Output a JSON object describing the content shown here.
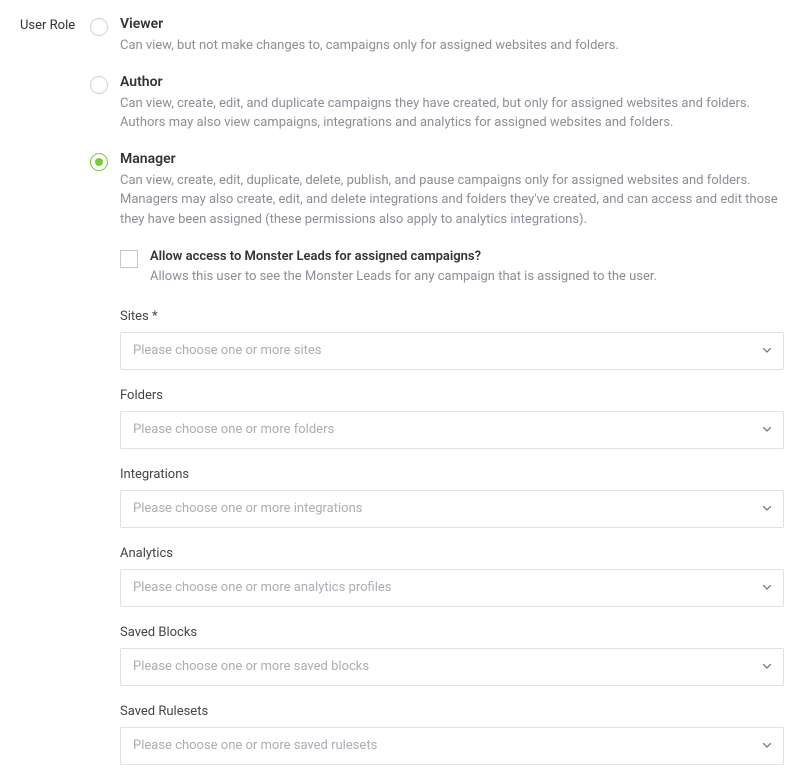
{
  "section_label": "User Role",
  "roles": {
    "viewer": {
      "title": "Viewer",
      "desc": "Can view, but not make changes to, campaigns only for assigned websites and folders."
    },
    "author": {
      "title": "Author",
      "desc": "Can view, create, edit, and duplicate campaigns they have created, but only for assigned websites and folders. Authors may also view campaigns, integrations and analytics for assigned websites and folders."
    },
    "manager": {
      "title": "Manager",
      "desc": "Can view, create, edit, duplicate, delete, publish, and pause campaigns only for assigned websites and folders. Managers may also create, edit, and delete integrations and folders they've created, and can access and edit those they have been assigned (these permissions also apply to analytics integrations)."
    }
  },
  "monster_leads": {
    "title": "Allow access to Monster Leads for assigned campaigns?",
    "desc": "Allows this user to see the Monster Leads for any campaign that is assigned to the user."
  },
  "fields": {
    "sites": {
      "label": "Sites *",
      "placeholder": "Please choose one or more sites"
    },
    "folders": {
      "label": "Folders",
      "placeholder": "Please choose one or more folders"
    },
    "integrations": {
      "label": "Integrations",
      "placeholder": "Please choose one or more integrations"
    },
    "analytics": {
      "label": "Analytics",
      "placeholder": "Please choose one or more analytics profiles"
    },
    "saved_blocks": {
      "label": "Saved Blocks",
      "placeholder": "Please choose one or more saved blocks"
    },
    "saved_rulesets": {
      "label": "Saved Rulesets",
      "placeholder": "Please choose one or more saved rulesets"
    }
  }
}
